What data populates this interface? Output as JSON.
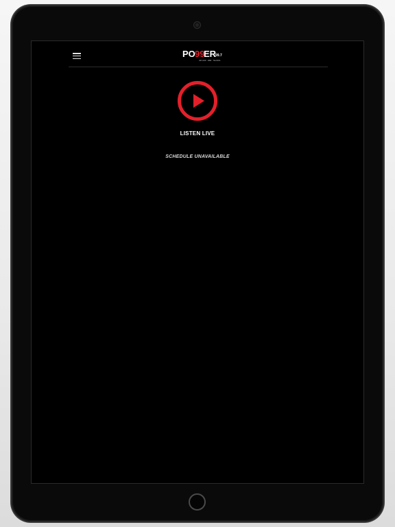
{
  "app": {
    "logo": {
      "wordmark_left": "PO",
      "wordmark_accent": "99",
      "wordmark_right": "ER",
      "frequency": "99.7",
      "tagline": "HIP HOP · R&B · TALKING"
    },
    "header": {
      "menu_icon": "hamburger-menu-icon"
    },
    "player": {
      "play_icon": "play-icon",
      "listen_label": "LISTEN LIVE"
    },
    "schedule": {
      "status_text": "SCHEDULE UNAVAILABLE"
    },
    "colors": {
      "accent": "#e3202a",
      "background": "#000000",
      "text": "#ffffff"
    }
  }
}
